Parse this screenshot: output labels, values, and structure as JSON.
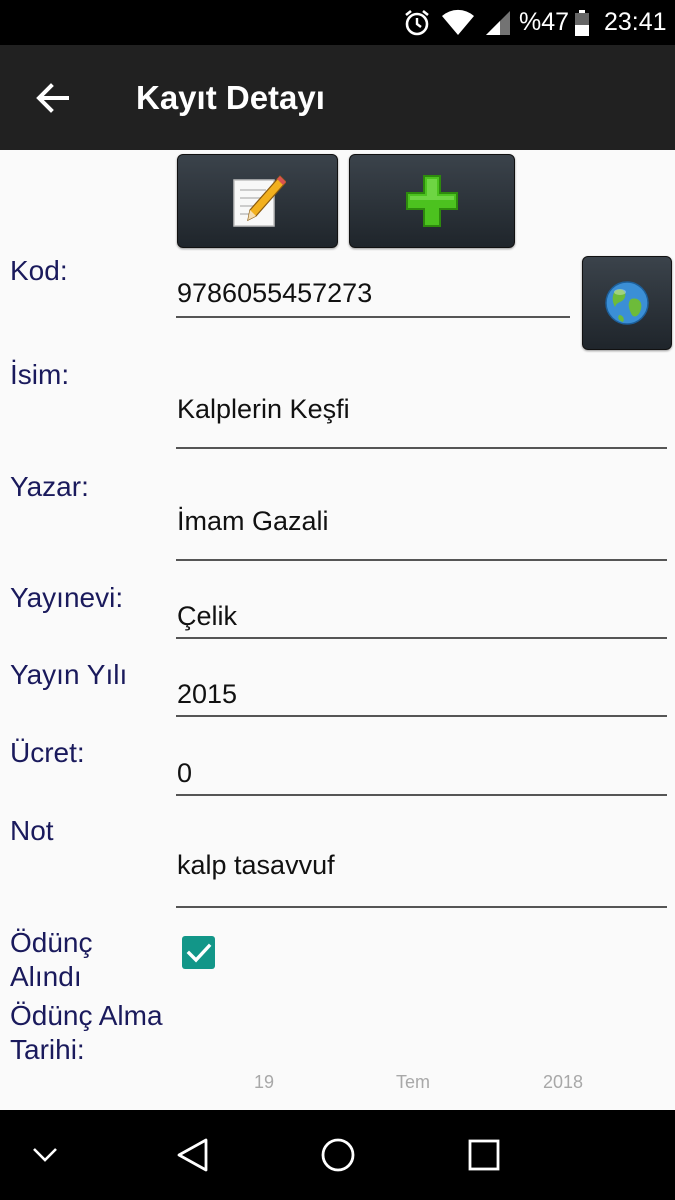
{
  "status_bar": {
    "battery": "%47",
    "time": "23:41",
    "icons": [
      "alarm-icon",
      "wifi-icon",
      "signal-icon",
      "battery-icon"
    ]
  },
  "app_bar": {
    "title": "Kayıt Detayı",
    "back_icon": "arrow-left-icon"
  },
  "toolbar": {
    "edit_icon": "edit-pencil-icon",
    "add_icon": "plus-icon",
    "web_icon": "globe-icon"
  },
  "form": {
    "kod": {
      "label": "Kod:",
      "value": "9786055457273"
    },
    "isim": {
      "label": "İsim:",
      "value": "Kalplerin Keşfi"
    },
    "yazar": {
      "label": "Yazar:",
      "value": "İmam Gazali"
    },
    "yayinevi": {
      "label": "Yayınevi:",
      "value": "Çelik"
    },
    "yayin_yili": {
      "label": "Yayın Yılı",
      "value": "2015"
    },
    "ucret": {
      "label": "Ücret:",
      "value": "0"
    },
    "not": {
      "label": "Not",
      "value": "kalp tasavvuf"
    },
    "odunc_alindi": {
      "label_line1": "Ödünç",
      "label_line2": "Alındı",
      "checked": true
    },
    "odunc_tarihi": {
      "label_line1": "Ödünç Alma",
      "label_line2": "Tarihi:",
      "day": "19",
      "month": "Tem",
      "year": "2018"
    }
  },
  "colors": {
    "status_bar": "#000000",
    "app_bar": "#212121",
    "label": "#1a1a5c",
    "checkbox": "#129688",
    "background": "#fafafa"
  },
  "nav_bar": {
    "icons": [
      "chevron-down-icon",
      "back-triangle-icon",
      "home-circle-icon",
      "recents-square-icon"
    ]
  }
}
